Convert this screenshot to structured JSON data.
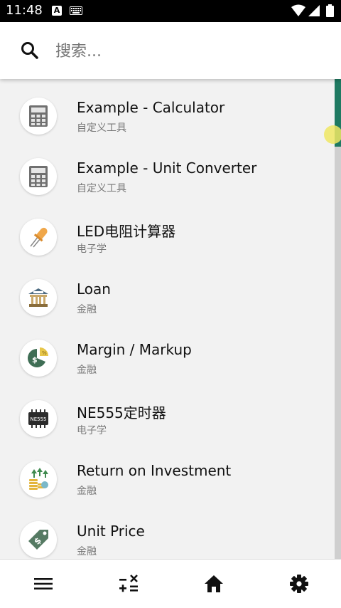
{
  "status_bar": {
    "time": "11:48",
    "icons": [
      "notification-a-icon",
      "keyboard-icon",
      "wifi-icon",
      "signal-icon",
      "battery-icon"
    ]
  },
  "search": {
    "placeholder": "搜索..."
  },
  "items": [
    {
      "title": "Example - Calculator",
      "subtitle": "自定义工具",
      "icon": "calculator-icon"
    },
    {
      "title": "Example - Unit Converter",
      "subtitle": "自定义工具",
      "icon": "calculator-icon"
    },
    {
      "title": "LED电阻计算器",
      "subtitle": "电子学",
      "icon": "led-icon"
    },
    {
      "title": "Loan",
      "subtitle": "金融",
      "icon": "bank-icon"
    },
    {
      "title": "Margin / Markup",
      "subtitle": "金融",
      "icon": "pie-money-icon"
    },
    {
      "title": "NE555定时器",
      "subtitle": "电子学",
      "icon": "chip-icon"
    },
    {
      "title": "Return on Investment",
      "subtitle": "金融",
      "icon": "coins-growth-icon"
    },
    {
      "title": "Unit Price",
      "subtitle": "金融",
      "icon": "price-tag-icon"
    }
  ],
  "bottom_nav": [
    "menu-icon",
    "calculator-ops-icon",
    "home-icon",
    "settings-icon"
  ],
  "colors": {
    "scroll_thumb": "#1f7a62",
    "background": "#f2f2f2"
  }
}
